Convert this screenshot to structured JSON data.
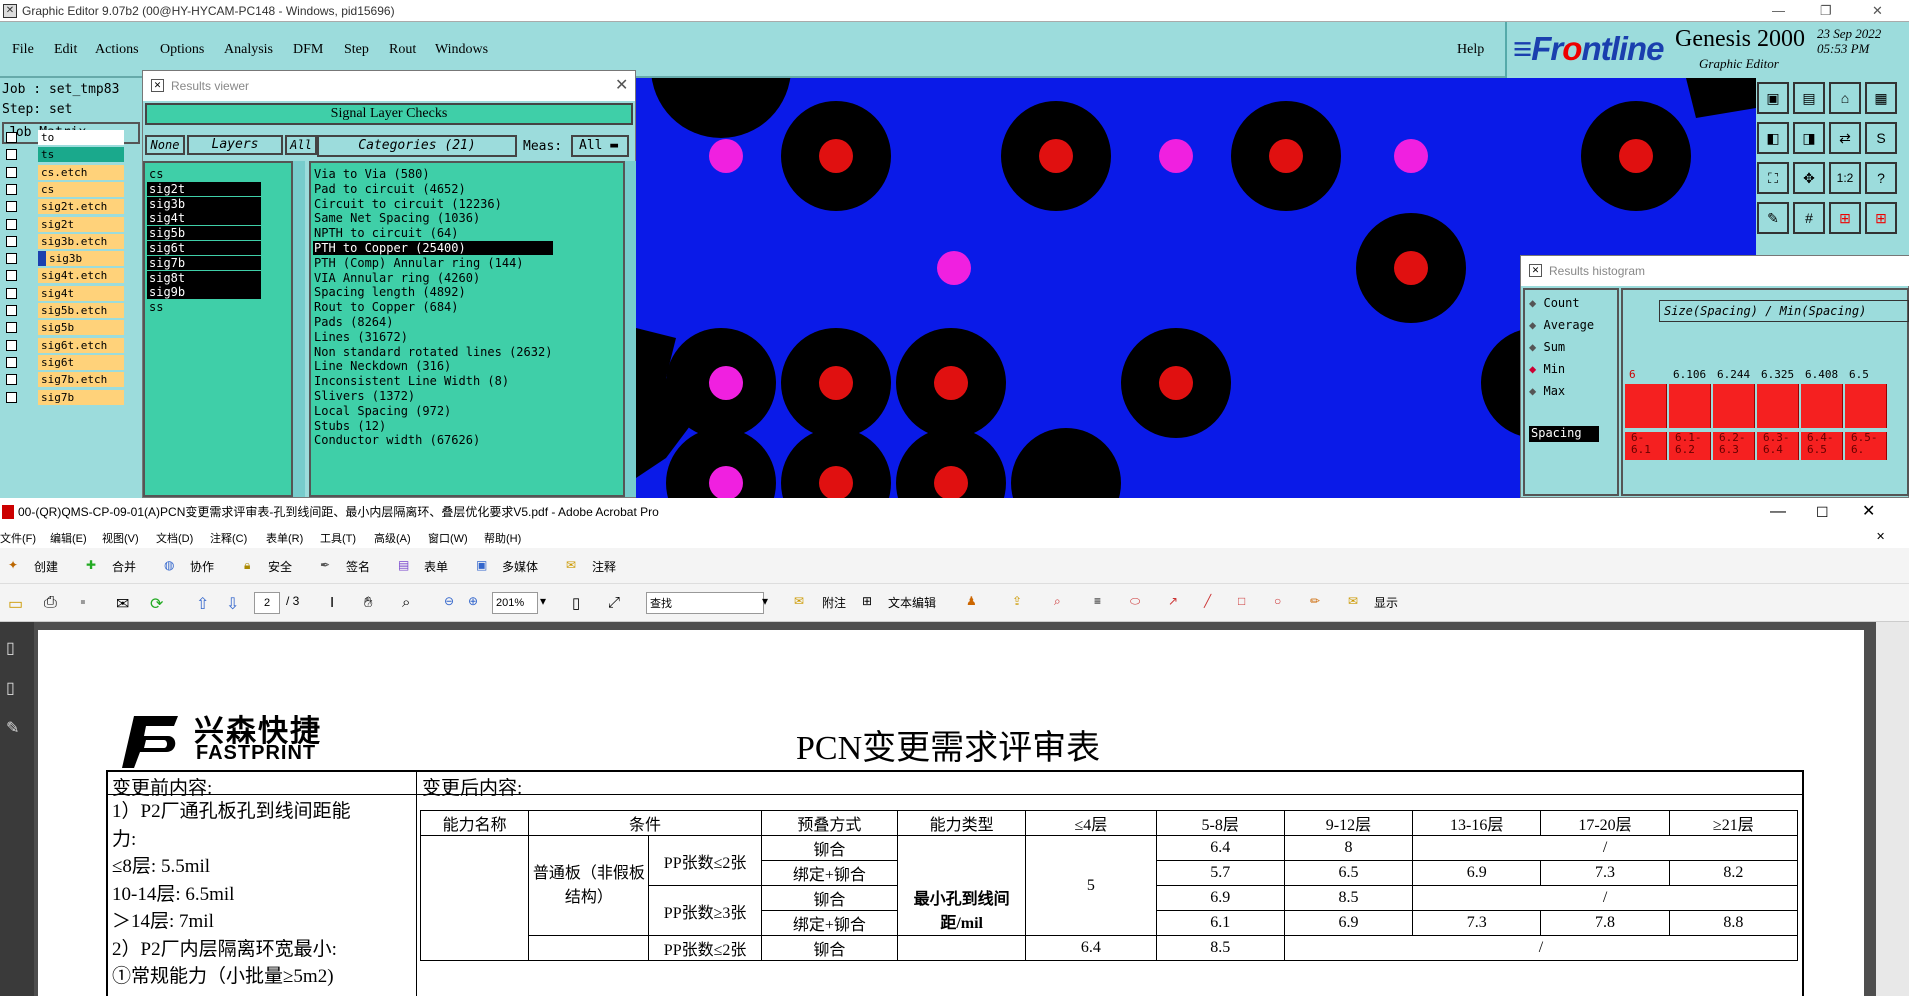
{
  "genesis": {
    "title": "Graphic Editor 9.07b2 (00@HY-HYCAM-PC148 - Windows, pid15696)",
    "menu": [
      "File",
      "Edit",
      "Actions",
      "Options",
      "Analysis",
      "DFM",
      "Step",
      "Rout",
      "Windows"
    ],
    "help": "Help",
    "logo": {
      "brand_a": "Fr",
      "brand_b": "o",
      "brand_c": "ntline",
      "product": "Genesis 2000",
      "sub": "Graphic Editor",
      "date": "23 Sep 2022\n05:53 PM"
    },
    "job_label": "Job : set_tmp83",
    "step_label": "Step: set",
    "job_matrix": "Job Matrix ...",
    "layers": [
      {
        "name": "to",
        "bg": "#ffffff"
      },
      {
        "name": "ts",
        "bg": "#1aa98c"
      },
      {
        "name": "cs.etch",
        "bg": "#ffd27a"
      },
      {
        "name": "cs",
        "bg": "#ffd27a"
      },
      {
        "name": "sig2t.etch",
        "bg": "#ffd27a"
      },
      {
        "name": "sig2t",
        "bg": "#ffd27a"
      },
      {
        "name": "sig3b.etch",
        "bg": "#ffd27a"
      },
      {
        "name": "sig3b",
        "bg": "#ffd27a"
      },
      {
        "name": "sig4t.etch",
        "bg": "#ffd27a"
      },
      {
        "name": "sig4t",
        "bg": "#ffd27a"
      },
      {
        "name": "sig5b.etch",
        "bg": "#ffd27a"
      },
      {
        "name": "sig5b",
        "bg": "#ffd27a"
      },
      {
        "name": "sig6t.etch",
        "bg": "#ffd27a"
      },
      {
        "name": "sig6t",
        "bg": "#ffd27a"
      },
      {
        "name": "sig7b.etch",
        "bg": "#ffd27a"
      },
      {
        "name": "sig7b",
        "bg": "#ffd27a"
      }
    ],
    "results_viewer": {
      "title": "Results viewer",
      "header": "Signal Layer Checks",
      "none": "None",
      "layers_btn": "Layers",
      "all": "All",
      "categories_btn": "Categories (21)",
      "meas": "Meas:",
      "meas_val": "All",
      "layer_list": [
        "cs",
        "sig2t",
        "sig3b",
        "sig4t",
        "sig5b",
        "sig6t",
        "sig7b",
        "sig8t",
        "sig9b",
        "ss"
      ],
      "categories": [
        "Via to Via (580)",
        "Pad to circuit (4652)",
        "Circuit to circuit (12236)",
        "Same Net Spacing (1036)",
        "NPTH to circuit (64)",
        "PTH to Copper (25400)",
        "PTH (Comp) Annular ring (144)",
        "VIA Annular ring (4260)",
        "Spacing length (4892)",
        "Rout to Copper (684)",
        "Pads (8264)",
        "Lines (31672)",
        "Non standard rotated lines (2632)",
        "Line Neckdown (316)",
        "Inconsistent Line Width (8)",
        "Slivers (1372)",
        "Local Spacing (972)",
        "Stubs (12)",
        "Conductor width (67626)"
      ]
    },
    "histogram": {
      "title": "Results histogram",
      "options": [
        "Count",
        "Average",
        "Sum",
        "Min",
        "Max"
      ],
      "spacing": "Spacing",
      "header": "Size(Spacing) / Min(Spacing)",
      "top_labels": [
        "6",
        "6.106",
        "6.244",
        "6.325",
        "6.408",
        "6.5"
      ],
      "bins": [
        "6-\n6.1",
        "6.1-\n6.2",
        "6.2-\n6.3",
        "6.3-\n6.4",
        "6.4-\n6.5",
        "6.5-\n6."
      ]
    }
  },
  "acrobat": {
    "title": "00-(QR)QMS-CP-09-01(A)PCN变更需求评审表-孔到线间距、最小内层隔离环、叠层优化要求V5.pdf - Adobe Acrobat Pro",
    "menu": [
      "文件(F)",
      "编辑(E)",
      "视图(V)",
      "文档(D)",
      "注释(C)",
      "表单(R)",
      "工具(T)",
      "高级(A)",
      "窗口(W)",
      "帮助(H)"
    ],
    "toolbar1": [
      "创建",
      "合并",
      "协作",
      "安全",
      "签名",
      "表单",
      "多媒体",
      "注释"
    ],
    "page_num": "2",
    "page_total": "/ 3",
    "zoom": "201%",
    "search": "查找",
    "toolbar2": [
      "附注",
      "文本编辑",
      "显示"
    ],
    "doc": {
      "logo_cn": "兴森快捷",
      "logo_en": "FASTPRINT",
      "title": "PCN变更需求评审表",
      "before_hdr": "变更前内容:",
      "after_hdr": "变更后内容:",
      "before_lines": [
        "1）P2厂通孔板孔到线间距能",
        "力:",
        "≤8层: 5.5mil",
        "10-14层: 6.5mil",
        "＞14层: 7mil",
        "2）P2厂内层隔离环宽最小:",
        "①常规能力（小批量≥5m2)"
      ],
      "headers": [
        "能力名称",
        "条件",
        "预叠方式",
        "能力类型",
        "≤4层",
        "5-8层",
        "9-12层",
        "13-16层",
        "17-20层",
        "≥21层"
      ],
      "cond1": "普通板（非假板结构）",
      "pp1": "PP张数≤2张",
      "pp2": "PP张数≥3张",
      "pp3": "PP张数≤2张",
      "m1": "铆合",
      "m2": "绑定+铆合",
      "captype": "最小孔到线间距/mil",
      "v4": "5",
      "v4b": "6.4",
      "r1": [
        "6.4",
        "8",
        "/"
      ],
      "r2": [
        "5.7",
        "6.5",
        "6.9",
        "7.3",
        "8.2"
      ],
      "r3": [
        "6.9",
        "8.5",
        "/"
      ],
      "r4": [
        "6.1",
        "6.9",
        "7.3",
        "7.8",
        "8.8"
      ],
      "r5": [
        "8.5",
        "/"
      ]
    }
  }
}
